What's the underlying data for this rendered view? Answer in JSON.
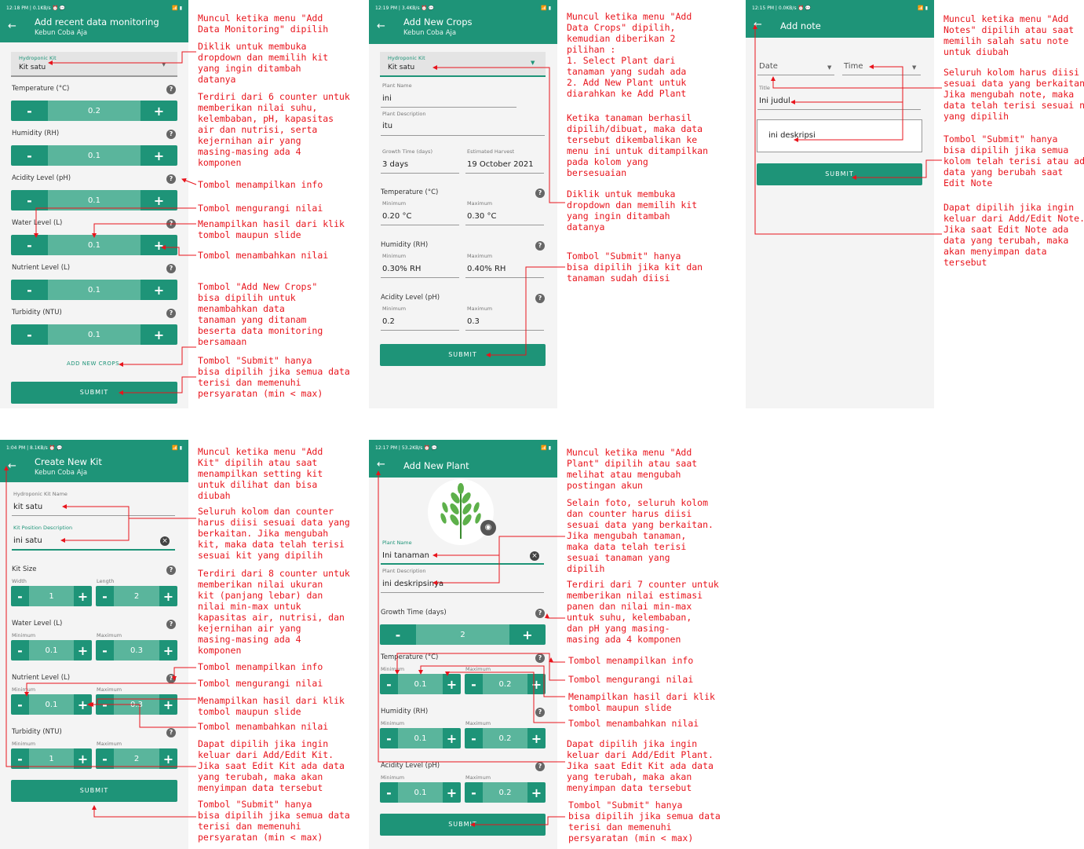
{
  "colors": {
    "primary": "#1e9478",
    "counter_mid": "#5ab59c",
    "annotation": "#e8141c"
  },
  "s1": {
    "status": "12:18 PM | 0.1KB/s ⏰ 💬",
    "title": "Add recent data monitoring",
    "subtitle": "Kebun Coba Aja",
    "kit_label": "Hydroponic Kit",
    "kit_value": "Kit satu",
    "c": [
      {
        "label": "Temperature (°C)",
        "value": "0.2"
      },
      {
        "label": "Humidity (RH)",
        "value": "0.1"
      },
      {
        "label": "Acidity Level (pH)",
        "value": "0.1"
      },
      {
        "label": "Water Level (L)",
        "value": "0.1"
      },
      {
        "label": "Nutrient Level (L)",
        "value": "0.1"
      },
      {
        "label": "Turbidity (NTU)",
        "value": "0.1"
      }
    ],
    "add_crops": "ADD NEW CROPS",
    "submit": "SUBMIT"
  },
  "s2": {
    "status": "12:19 PM | 3.4KB/s ⏰ 💬",
    "title": "Add New Crops",
    "subtitle": "Kebun Coba Aja",
    "kit_label": "Hydroponic Kit",
    "kit_value": "Kit satu",
    "plant_name_label": "Plant Name",
    "plant_name": "ini",
    "desc_label": "Plant Description",
    "desc": "itu",
    "growth_label": "Growth Time (days)",
    "growth": "3 days",
    "harvest_label": "Estimated Harvest",
    "harvest": "19 October 2021",
    "min": "Minimum",
    "max": "Maximum",
    "temp_label": "Temperature (°C)",
    "temp_min": "0.20 °C",
    "temp_max": "0.30 °C",
    "hum_label": "Humidity (RH)",
    "hum_min": "0.30% RH",
    "hum_max": "0.40% RH",
    "ph_label": "Acidity Level (pH)",
    "ph_min": "0.2",
    "ph_max": "0.3",
    "submit": "SUBMIT"
  },
  "s3": {
    "status": "12:15 PM | 0.0KB/s ⏰ 💬",
    "title": "Add note",
    "date": "Date",
    "time": "Time",
    "title_label": "Title",
    "title_value": "Ini judul",
    "desc": "ini deskripsi",
    "submit": "SUBMIT"
  },
  "s4": {
    "status": "1:04 PM | 8.1KB/s ⏰ 💬",
    "title": "Create New Kit",
    "subtitle": "Kebun Coba Aja",
    "name_label": "Hydroponic Kit Name",
    "name": "kit satu",
    "pos_label": "Kit Position Description",
    "pos": "ini satu",
    "kit_size": "Kit Size",
    "width": "Width",
    "length": "Length",
    "w": "1",
    "l": "2",
    "min": "Minimum",
    "max": "Maximum",
    "water": "Water Level (L)",
    "water_min": "0.1",
    "water_max": "0.3",
    "nutrient": "Nutrient Level (L)",
    "nut_min": "0.1",
    "nut_max": "0.3",
    "turb": "Turbidity (NTU)",
    "turb_min": "1",
    "turb_max": "2",
    "submit": "SUBMIT"
  },
  "s5": {
    "status": "12:17 PM | 53.2KB/s ⏰ 💬",
    "title": "Add New Plant",
    "name_label": "Plant Name",
    "name": "Ini tanaman",
    "desc_label": "Plant Description",
    "desc": "ini deskripsinya",
    "growth": "Growth Time (days)",
    "growth_val": "2",
    "min": "Minimum",
    "max": "Maximum",
    "temp": "Temperature (°C)",
    "temp_min": "0.1",
    "temp_max": "0.2",
    "hum": "Humidity (RH)",
    "hum_min": "0.1",
    "hum_max": "0.2",
    "ph": "Acidity Level (pH)",
    "ph_min": "0.1",
    "ph_max": "0.2",
    "submit": "SUBMIT"
  },
  "notes": {
    "n1": "Muncul ketika menu \"Add\nData Monitoring\" dipilih",
    "n2": "Diklik untuk membuka\ndropdown dan memilih kit\nyang ingin ditambah\ndatanya",
    "n3": "Terdiri dari 6 counter untuk\nmemberikan nilai suhu,\nkelembaban, pH, kapasitas\nair dan nutrisi, serta\nkejernihan air yang\nmasing-masing ada 4\nkomponen",
    "n4": "Tombol menampilkan info",
    "n5": "Tombol mengurangi nilai",
    "n6": "Menampilkan hasil dari klik\ntombol maupun slide",
    "n7": "Tombol menambahkan nilai",
    "n8": "Tombol \"Add New Crops\"\nbisa dipilih untuk\nmenambahkan data\ntanaman yang ditanam\nbeserta data monitoring\nbersamaan",
    "n9": "Tombol \"Submit\" hanya\nbisa dipilih jika semua data\nterisi dan memenuhi\npersyaratan (min < max)",
    "m1": "Muncul ketika menu \"Add\nData Crops\" dipilih,\nkemudian diberikan 2\npilihan :\n1. Select Plant dari\ntanaman yang sudah ada\n2. Add New Plant untuk\ndiarahkan ke Add Plant",
    "m2": "Ketika tanaman berhasil\ndipilih/dibuat, maka data\ntersebut dikembalikan ke\nmenu ini untuk ditampilkan\npada kolom yang\nbersesuaian",
    "m3": "Diklik untuk membuka\ndropdown dan memilih kit\nyang ingin ditambah\ndatanya",
    "m4": "Tombol \"Submit\" hanya\nbisa dipilih jika kit dan\ntanaman sudah diisi",
    "r1": "Muncul ketika menu \"Add\nNotes\" dipilih atau saat\nmemilih salah satu note\nuntuk diubah",
    "r2": "Seluruh kolom harus diisi\nsesuai data yang berkaitan.\nJika mengubah note, maka\ndata telah terisi sesuai note\nyang dipilih",
    "r3": "Tombol \"Submit\" hanya\nbisa dipilih jika semua\nkolom telah terisi atau ada\ndata yang berubah saat\nEdit Note",
    "r4": "Dapat dipilih jika ingin\nkeluar dari Add/Edit Note.\nJika saat Edit Note ada\ndata yang terubah, maka\nakan menyimpan data\ntersebut",
    "k1": "Muncul ketika menu \"Add\nKit\" dipilih atau saat\nmenampilkan setting kit\nuntuk dilihat dan bisa\ndiubah",
    "k2": "Seluruh kolom dan counter\nharus diisi sesuai data yang\nberkaitan. Jika mengubah\nkit, maka data telah terisi\nsesuai kit yang dipilih",
    "k3": "Terdiri dari 8 counter untuk\nmemberikan nilai ukuran\nkit (panjang lebar) dan\nnilai min-max untuk\nkapasitas air, nutrisi, dan\nkejernihan air yang\nmasing-masing ada 4\nkomponen",
    "k4": "Tombol menampilkan info",
    "k5": "Tombol mengurangi nilai",
    "k6": "Menampilkan hasil dari klik\ntombol maupun slide",
    "k7": "Tombol menambahkan nilai",
    "k8": "Dapat dipilih jika ingin\nkeluar dari Add/Edit Kit.\nJika saat Edit Kit ada data\nyang terubah, maka akan\nmenyimpan data tersebut",
    "k9": "Tombol \"Submit\" hanya\nbisa dipilih jika semua data\nterisi dan memenuhi\npersyaratan (min < max)",
    "p1": "Muncul ketika menu \"Add\nPlant\" dipilih atau saat\nmelihat atau mengubah\npostingan akun",
    "p2": "Selain foto, seluruh kolom\ndan counter harus diisi\nsesuai data yang berkaitan.\nJika mengubah tanaman,\nmaka data telah terisi\nsesuai tanaman yang\ndipilih",
    "p3": "Terdiri dari 7 counter untuk\nmemberikan nilai estimasi\npanen dan nilai min-max\nuntuk suhu, kelembaban,\ndan pH yang masing-\nmasing ada 4 komponen",
    "p4": "Tombol menampilkan info",
    "p5": "Tombol mengurangi nilai",
    "p6": "Menampilkan hasil dari klik\ntombol maupun slide",
    "p7": "Tombol menambahkan nilai",
    "p8": "Dapat dipilih jika ingin\nkeluar dari Add/Edit Plant.\nJika saat Edit Kit ada data\nyang terubah, maka akan\nmenyimpan data tersebut",
    "p9": "Tombol \"Submit\" hanya\nbisa dipilih jika semua data\nterisi dan memenuhi\npersyaratan (min < max)"
  }
}
